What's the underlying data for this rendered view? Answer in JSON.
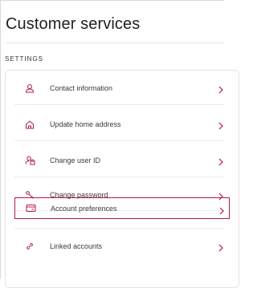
{
  "page": {
    "title": "Customer services"
  },
  "settings": {
    "section_label": "SETTINGS",
    "items": [
      {
        "label": "Contact information",
        "icon": "person-icon"
      },
      {
        "label": "Update home address",
        "icon": "home-icon"
      },
      {
        "label": "Change user ID",
        "icon": "user-lock-icon"
      },
      {
        "label": "Change password",
        "icon": "key-icon"
      },
      {
        "label": "Account preferences",
        "icon": "card-icon",
        "selected": true
      },
      {
        "label": "Linked accounts",
        "icon": "link-icon"
      }
    ]
  },
  "colors": {
    "accent": "#b01855",
    "text": "#222222",
    "border": "#e3e3e3"
  }
}
